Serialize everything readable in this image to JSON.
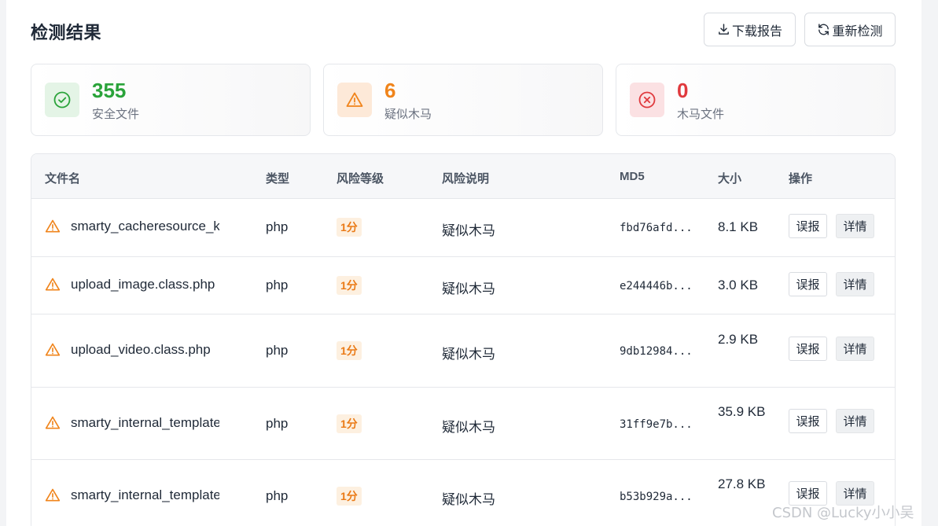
{
  "header": {
    "title": "检测结果",
    "download_label": "下载报告",
    "redetect_label": "重新检测"
  },
  "stats": [
    {
      "value": "355",
      "label": "安全文件",
      "color": "#2aa33a",
      "bg": "#e4f4e6",
      "icon": "check-circle-icon"
    },
    {
      "value": "6",
      "label": "疑似木马",
      "color": "#f0841b",
      "bg": "#fde9d8",
      "icon": "warning-triangle-icon"
    },
    {
      "value": "0",
      "label": "木马文件",
      "color": "#e03a3e",
      "bg": "#fbe1e3",
      "icon": "x-circle-icon"
    }
  ],
  "table": {
    "columns": [
      "文件名",
      "类型",
      "风险等级",
      "风险说明",
      "MD5",
      "大小",
      "操作"
    ],
    "rows": [
      {
        "name": "smarty_cacheresource_keyvaluestore.php",
        "type": "php",
        "risk": "1分",
        "desc": "疑似木马",
        "md5": "fbd76afd...",
        "size": "8.1 KB"
      },
      {
        "name": "upload_image.class.php",
        "type": "php",
        "risk": "1分",
        "desc": "疑似木马",
        "md5": "e244446b...",
        "size": "3.0 KB"
      },
      {
        "name": "upload_video.class.php",
        "type": "php",
        "risk": "1分",
        "desc": "疑似木马",
        "md5": "9db12984...",
        "size": "2.9 KB"
      },
      {
        "name": "smarty_internal_template.php",
        "type": "php",
        "risk": "1分",
        "desc": "疑似木马",
        "md5": "31ff9e7b...",
        "size": "35.9 KB"
      },
      {
        "name": "smarty_internal_templatebase.php",
        "type": "php",
        "risk": "1分",
        "desc": "疑似木马",
        "md5": "b53b929a...",
        "size": "27.8 KB"
      }
    ],
    "report_label": "误报",
    "detail_label": "详情"
  },
  "watermark": "CSDN @Lucky小小吴"
}
